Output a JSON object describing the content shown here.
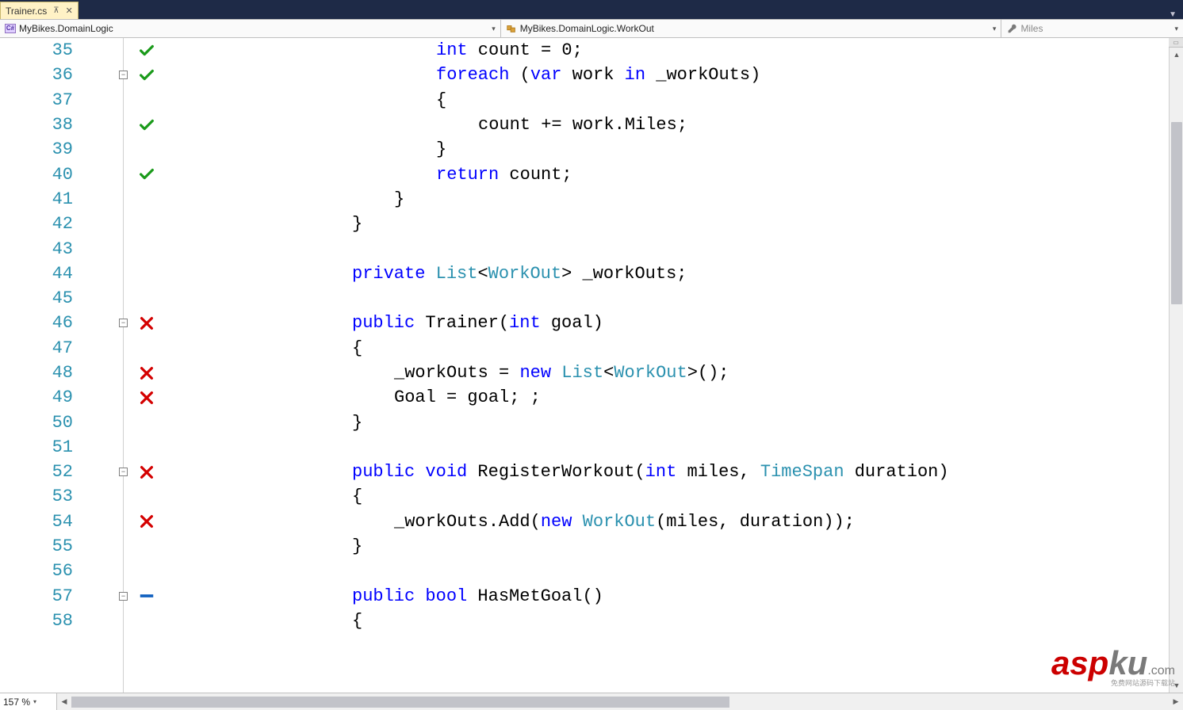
{
  "tab": {
    "label": "Trainer.cs"
  },
  "nav": {
    "namespace": "MyBikes.DomainLogic",
    "class": "MyBikes.DomainLogic.WorkOut",
    "member": "Miles"
  },
  "zoom": "157 %",
  "watermark": {
    "text1": "asp",
    "text2": "ku",
    "suffix": ".com",
    "tagline": "免费网站源码下载站"
  },
  "lines": [
    {
      "n": 35,
      "fold": "",
      "status": "pass",
      "indent": 4,
      "tokens": [
        [
          "kw",
          "int"
        ],
        [
          "txt",
          " count = 0;"
        ]
      ]
    },
    {
      "n": 36,
      "fold": "-",
      "status": "pass",
      "indent": 4,
      "tokens": [
        [
          "kw",
          "foreach"
        ],
        [
          "txt",
          " ("
        ],
        [
          "kw",
          "var"
        ],
        [
          "txt",
          " work "
        ],
        [
          "kw",
          "in"
        ],
        [
          "txt",
          " _workOuts)"
        ]
      ]
    },
    {
      "n": 37,
      "fold": "",
      "status": "",
      "indent": 4,
      "tokens": [
        [
          "txt",
          "{"
        ]
      ]
    },
    {
      "n": 38,
      "fold": "",
      "status": "pass",
      "indent": 5,
      "tokens": [
        [
          "txt",
          "count += work.Miles;"
        ]
      ]
    },
    {
      "n": 39,
      "fold": "",
      "status": "",
      "indent": 4,
      "tokens": [
        [
          "txt",
          "}"
        ]
      ]
    },
    {
      "n": 40,
      "fold": "",
      "status": "pass",
      "indent": 4,
      "tokens": [
        [
          "kw",
          "return"
        ],
        [
          "txt",
          " count;"
        ]
      ]
    },
    {
      "n": 41,
      "fold": "",
      "status": "",
      "indent": 3,
      "tokens": [
        [
          "txt",
          "}"
        ]
      ]
    },
    {
      "n": 42,
      "fold": "",
      "status": "",
      "indent": 2,
      "tokens": [
        [
          "txt",
          "}"
        ]
      ]
    },
    {
      "n": 43,
      "fold": "",
      "status": "",
      "indent": 0,
      "tokens": []
    },
    {
      "n": 44,
      "fold": "",
      "status": "",
      "indent": 2,
      "tokens": [
        [
          "kw",
          "private"
        ],
        [
          "txt",
          " "
        ],
        [
          "type",
          "List"
        ],
        [
          "txt",
          "<"
        ],
        [
          "type",
          "WorkOut"
        ],
        [
          "txt",
          "> _workOuts;"
        ]
      ]
    },
    {
      "n": 45,
      "fold": "",
      "status": "",
      "indent": 0,
      "tokens": []
    },
    {
      "n": 46,
      "fold": "-",
      "status": "fail",
      "indent": 2,
      "tokens": [
        [
          "kw",
          "public"
        ],
        [
          "txt",
          " Trainer("
        ],
        [
          "kw",
          "int"
        ],
        [
          "txt",
          " goal)"
        ]
      ]
    },
    {
      "n": 47,
      "fold": "",
      "status": "",
      "indent": 2,
      "tokens": [
        [
          "txt",
          "{"
        ]
      ]
    },
    {
      "n": 48,
      "fold": "",
      "status": "fail",
      "indent": 3,
      "tokens": [
        [
          "txt",
          "_workOuts = "
        ],
        [
          "kw",
          "new"
        ],
        [
          "txt",
          " "
        ],
        [
          "type",
          "List"
        ],
        [
          "txt",
          "<"
        ],
        [
          "type",
          "WorkOut"
        ],
        [
          "txt",
          ">();"
        ]
      ]
    },
    {
      "n": 49,
      "fold": "",
      "status": "fail",
      "indent": 3,
      "tokens": [
        [
          "txt",
          "Goal = goal; ;"
        ]
      ]
    },
    {
      "n": 50,
      "fold": "",
      "status": "",
      "indent": 2,
      "tokens": [
        [
          "txt",
          "}"
        ]
      ]
    },
    {
      "n": 51,
      "fold": "",
      "status": "",
      "indent": 0,
      "tokens": []
    },
    {
      "n": 52,
      "fold": "-",
      "status": "fail",
      "indent": 2,
      "tokens": [
        [
          "kw",
          "public"
        ],
        [
          "txt",
          " "
        ],
        [
          "kw",
          "void"
        ],
        [
          "txt",
          " RegisterWorkout("
        ],
        [
          "kw",
          "int"
        ],
        [
          "txt",
          " miles, "
        ],
        [
          "type",
          "TimeSpan"
        ],
        [
          "txt",
          " duration)"
        ]
      ]
    },
    {
      "n": 53,
      "fold": "",
      "status": "",
      "indent": 2,
      "tokens": [
        [
          "txt",
          "{"
        ]
      ]
    },
    {
      "n": 54,
      "fold": "",
      "status": "fail",
      "indent": 3,
      "tokens": [
        [
          "txt",
          "_workOuts.Add("
        ],
        [
          "kw",
          "new"
        ],
        [
          "txt",
          " "
        ],
        [
          "type",
          "WorkOut"
        ],
        [
          "txt",
          "(miles, duration));"
        ]
      ]
    },
    {
      "n": 55,
      "fold": "",
      "status": "",
      "indent": 2,
      "tokens": [
        [
          "txt",
          "}"
        ]
      ]
    },
    {
      "n": 56,
      "fold": "",
      "status": "",
      "indent": 0,
      "tokens": []
    },
    {
      "n": 57,
      "fold": "-",
      "status": "none",
      "indent": 2,
      "tokens": [
        [
          "kw",
          "public"
        ],
        [
          "txt",
          " "
        ],
        [
          "kw",
          "bool"
        ],
        [
          "txt",
          " HasMetGoal()"
        ]
      ]
    },
    {
      "n": 58,
      "fold": "",
      "status": "",
      "indent": 2,
      "tokens": [
        [
          "txt",
          "{"
        ]
      ]
    }
  ]
}
